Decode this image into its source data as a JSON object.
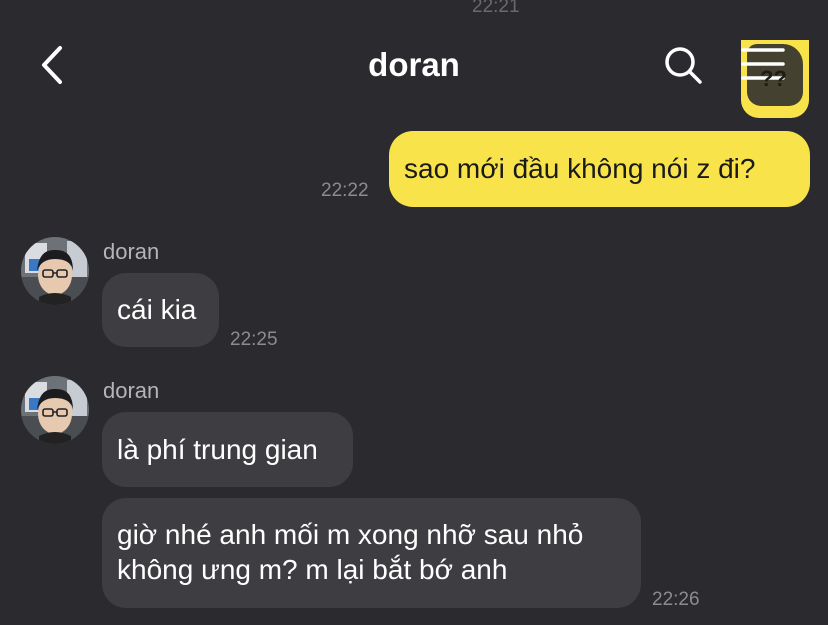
{
  "status": {
    "previous_time": "22:21"
  },
  "header": {
    "title": "doran",
    "back_icon": "chevron-left-icon",
    "search_icon": "search-icon",
    "menu_icon": "hamburger-menu-icon"
  },
  "peek_bubble": {
    "text": "??"
  },
  "messages": [
    {
      "direction": "outgoing",
      "text": "sao mới đầu không nói z đi?",
      "time": "22:22"
    },
    {
      "direction": "incoming",
      "sender": "doran",
      "text": "cái kia",
      "time": "22:25"
    },
    {
      "direction": "incoming",
      "sender": "doran",
      "text": "là phí trung gian"
    },
    {
      "direction": "incoming",
      "text_line1": "giờ nhé anh mối m xong nhỡ sau nhỏ",
      "text_line2": "không ưng m? m lại bắt bớ anh",
      "time": "22:26"
    }
  ],
  "colors": {
    "background": "#2b2a2e",
    "outgoing_bubble": "#f9e34b",
    "incoming_bubble": "#3e3d42"
  }
}
